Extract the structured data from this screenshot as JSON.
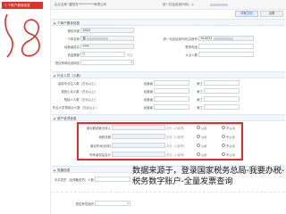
{
  "sidebar": {
    "step_tab": "1.个体户基础信息"
  },
  "top_bar": {
    "company_label": "企业名称：",
    "company_value": "襄阳市**********有限公司",
    "credit_label": "统一社会信用代码(...):",
    "help_button": "帮助文档",
    "config_button": "设置"
  },
  "section_basic": {
    "fields": [
      {
        "label": "报告年度",
        "value": "2022"
      },
      {
        "label": "个体名称",
        "value": "襄"
      },
      {
        "label": "经营者姓名",
        "value": "****"
      },
      {
        "label": "资金数额",
        "value": "0",
        "suffix": "万元"
      },
      {
        "label": "是否有网站或网店",
        "value": ""
      }
    ],
    "right_fields": [
      {
        "label": "统一社会信用代码/注册号",
        "value": "914211"
      },
      {
        "label": "联系电话",
        "value": ""
      },
      {
        "label": "从业人数",
        "value": ""
      }
    ]
  },
  "section_person": {
    "title": "行业人员（人数）",
    "rows": [
      {
        "label": "高校毕业生人数（万元以上）",
        "mid_label": "经营者",
        "right_label": "雇工"
      },
      {
        "label": "退役士兵人数（万元以上）",
        "mid_label": "经营者",
        "right_label": "雇工"
      },
      {
        "label": "残疾人人数（万元以上）",
        "mid_label": "经营者",
        "right_label": "雇工"
      },
      {
        "label": "失业人员再就业人数（万元以上）",
        "mid_label": "经营者",
        "right_label": "雇工"
      }
    ]
  },
  "section_assets": {
    "title": "资产状况信息",
    "rows": [
      {
        "label": "营业额或营业收入",
        "unit": "万元（人民币）",
        "opt_a": "公示",
        "opt_b": "不公示"
      },
      {
        "label": "纳税总额",
        "unit": "万元（人民币）",
        "opt_a": "公示",
        "opt_b": "不公示"
      },
      {
        "label": "营业利润(必填)",
        "unit": "万元（人民币）",
        "opt_a": "公示",
        "opt_b": "不公示"
      },
      {
        "label": "所有者权益合计",
        "unit": "万元（人民币）",
        "opt_a": "公示",
        "opt_b": "不公示"
      }
    ]
  },
  "section_party": {
    "title": "党建信息",
    "rows": [
      {
        "label": "中共党员（含预备党员）人数",
        "unit": "人"
      },
      {
        "label": "是否有党组织",
        "unit": ""
      }
    ]
  },
  "watermark": {
    "line1": "数据来源于，登录国家税务总局-我要办税-",
    "line2": "税务数字账户-全量发票查询"
  },
  "colors": {
    "accent_red": "#e0312b",
    "highlight": "#e02b27",
    "section_bg": "#f2f6fb"
  }
}
